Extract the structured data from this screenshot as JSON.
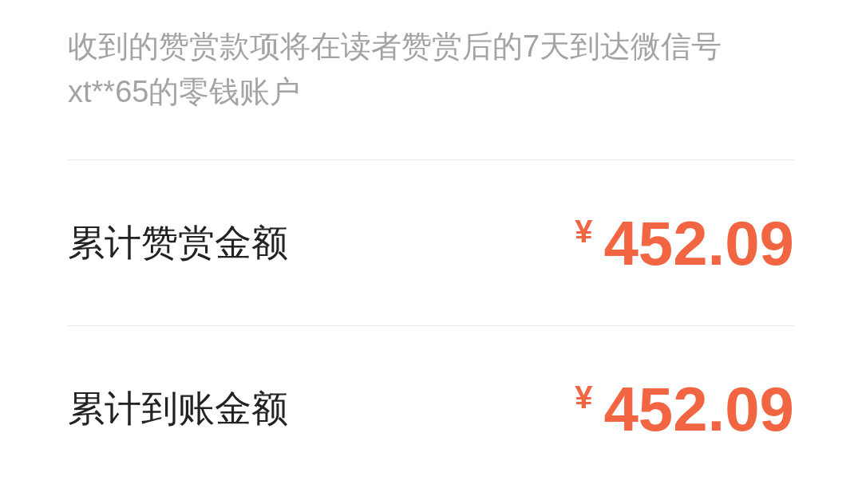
{
  "notice": "收到的赞赏款项将在读者赞赏后的7天到达微信号xt**65的零钱账户",
  "rows": [
    {
      "label": "累计赞赏金额",
      "currency": "¥",
      "amount": "452.09"
    },
    {
      "label": "累计到账金额",
      "currency": "¥",
      "amount": "452.09"
    }
  ]
}
